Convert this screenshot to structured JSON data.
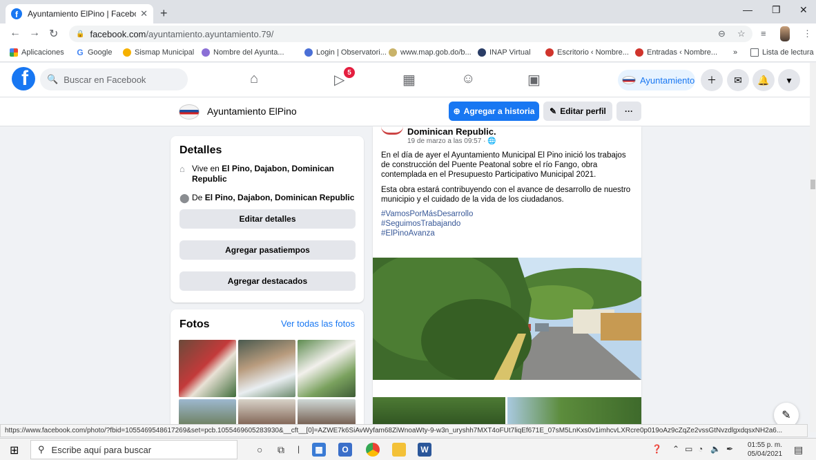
{
  "browser": {
    "tab_title": "Ayuntamiento ElPino | Facebook",
    "url_host": "facebook.com",
    "url_path": "/ayuntamiento.ayuntamiento.79/",
    "bookmarks": [
      "Aplicaciones",
      "Google",
      "Sismap Municipal",
      "Nombre del Ayunta...",
      "Login | Observatori...",
      "www.map.gob.do/b...",
      "INAP Virtual",
      "Escritorio ‹ Nombre...",
      "Entradas ‹ Nombre..."
    ],
    "reading_list": "Lista de lectura",
    "more_bookmarks": "»",
    "status_url": "https://www.facebook.com/photo/?fbid=1055469548617269&set=pcb.1055469605283930&__cft__[0]=AZWE7k6SiAvWyfam68ZiWnoaWty-9-w3n_uryshh7MXT4oFUt7liqEf671E_07sM5LnKxs0v1imhcvLXRcre0p019oAz9cZqZe2vssGtNvzdlgxdqsxNH2a6..."
  },
  "fb": {
    "search_placeholder": "Buscar en Facebook",
    "video_badge": "5",
    "user_pill": "Ayuntamiento",
    "accent": "#1877f2"
  },
  "profile_bar": {
    "name": "Ayuntamiento ElPino",
    "add_story": "Agregar a historia",
    "edit_profile": "Editar perfil",
    "more": "···"
  },
  "details": {
    "title": "Detalles",
    "lives_prefix": "Vive en ",
    "lives_place": "El Pino, Dajabon, Dominican Republic",
    "from_prefix": "De ",
    "from_place": "El Pino, Dajabon, Dominican Republic",
    "edit_details": "Editar detalles",
    "add_hobbies": "Agregar pasatiempos",
    "add_featured": "Agregar destacados"
  },
  "photos": {
    "title": "Fotos",
    "see_all": "Ver todas las fotos"
  },
  "post": {
    "author_tail": "Dominican Republic.",
    "date": "19 de marzo a las 09:57 ·",
    "para1": "En el día de ayer el Ayuntamiento Municipal El Pino inició los trabajos de construcción del Puente Peatonal sobre el río Fango, obra contemplada en el Presupuesto Participativo Municipal 2021.",
    "para2": "Esta obra estará contribuyendo con el avance de desarrollo de nuestro municipio y el cuidado de la vida de los ciudadanos.",
    "hashtags": [
      "#VamosPorMásDesarrollo",
      "#SeguimosTrabajando",
      "#ElPinoAvanza"
    ]
  },
  "taskbar": {
    "search_placeholder": "Escribe aquí para buscar",
    "time": "01:55 p. m.",
    "date": "05/04/2021"
  }
}
